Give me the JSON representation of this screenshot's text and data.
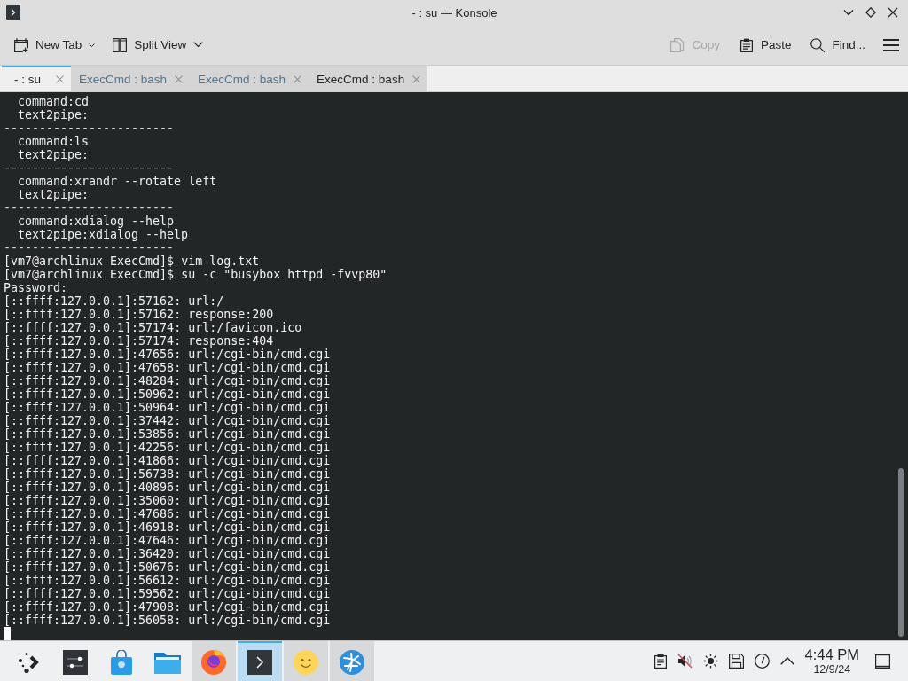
{
  "window": {
    "title": "- : su — Konsole"
  },
  "toolbar": {
    "left": [
      {
        "label": "New Tab",
        "disabled": false
      },
      {
        "label": "Split View",
        "disabled": false
      }
    ],
    "right": [
      {
        "label": "Copy",
        "disabled": true
      },
      {
        "label": "Paste",
        "disabled": false
      },
      {
        "label": "Find...",
        "disabled": false
      }
    ]
  },
  "tabs": [
    {
      "label": "- : su",
      "selected": true,
      "activity": false
    },
    {
      "label": "ExecCmd : bash",
      "selected": false,
      "activity": true
    },
    {
      "label": "ExecCmd : bash",
      "selected": false,
      "activity": true
    },
    {
      "label": "ExecCmd : bash",
      "selected": false,
      "activity": false
    }
  ],
  "terminal": {
    "lines": [
      {
        "kind": "field",
        "text": "command:cd"
      },
      {
        "kind": "field",
        "text": "text2pipe:"
      },
      {
        "kind": "rule",
        "text": "------------------------"
      },
      {
        "kind": "field",
        "text": "command:ls"
      },
      {
        "kind": "field",
        "text": "text2pipe:"
      },
      {
        "kind": "rule",
        "text": "------------------------"
      },
      {
        "kind": "field",
        "text": "command:xrandr --rotate left"
      },
      {
        "kind": "field",
        "text": "text2pipe:"
      },
      {
        "kind": "rule",
        "text": "------------------------"
      },
      {
        "kind": "field",
        "text": "command:xdialog --help"
      },
      {
        "kind": "field",
        "text": "text2pipe:xdialog --help"
      },
      {
        "kind": "rule",
        "text": "------------------------"
      },
      {
        "kind": "line",
        "text": "[vm7@archlinux ExecCmd]$ vim log.txt"
      },
      {
        "kind": "line",
        "text": "[vm7@archlinux ExecCmd]$ su -c \"busybox httpd -fvvp80\""
      },
      {
        "kind": "line",
        "text": "Password:"
      },
      {
        "kind": "line",
        "text": "[::ffff:127.0.0.1]:57162: url:/"
      },
      {
        "kind": "line",
        "text": "[::ffff:127.0.0.1]:57162: response:200"
      },
      {
        "kind": "line",
        "text": "[::ffff:127.0.0.1]:57174: url:/favicon.ico"
      },
      {
        "kind": "line",
        "text": "[::ffff:127.0.0.1]:57174: response:404"
      },
      {
        "kind": "line",
        "text": "[::ffff:127.0.0.1]:47656: url:/cgi-bin/cmd.cgi"
      },
      {
        "kind": "line",
        "text": "[::ffff:127.0.0.1]:47658: url:/cgi-bin/cmd.cgi"
      },
      {
        "kind": "line",
        "text": "[::ffff:127.0.0.1]:48284: url:/cgi-bin/cmd.cgi"
      },
      {
        "kind": "line",
        "text": "[::ffff:127.0.0.1]:50962: url:/cgi-bin/cmd.cgi"
      },
      {
        "kind": "line",
        "text": "[::ffff:127.0.0.1]:50964: url:/cgi-bin/cmd.cgi"
      },
      {
        "kind": "line",
        "text": "[::ffff:127.0.0.1]:37442: url:/cgi-bin/cmd.cgi"
      },
      {
        "kind": "line",
        "text": "[::ffff:127.0.0.1]:53856: url:/cgi-bin/cmd.cgi"
      },
      {
        "kind": "line",
        "text": "[::ffff:127.0.0.1]:42256: url:/cgi-bin/cmd.cgi"
      },
      {
        "kind": "line",
        "text": "[::ffff:127.0.0.1]:41866: url:/cgi-bin/cmd.cgi"
      },
      {
        "kind": "line",
        "text": "[::ffff:127.0.0.1]:56738: url:/cgi-bin/cmd.cgi"
      },
      {
        "kind": "line",
        "text": "[::ffff:127.0.0.1]:40896: url:/cgi-bin/cmd.cgi"
      },
      {
        "kind": "line",
        "text": "[::ffff:127.0.0.1]:35060: url:/cgi-bin/cmd.cgi"
      },
      {
        "kind": "line",
        "text": "[::ffff:127.0.0.1]:47686: url:/cgi-bin/cmd.cgi"
      },
      {
        "kind": "line",
        "text": "[::ffff:127.0.0.1]:46918: url:/cgi-bin/cmd.cgi"
      },
      {
        "kind": "line",
        "text": "[::ffff:127.0.0.1]:47646: url:/cgi-bin/cmd.cgi"
      },
      {
        "kind": "line",
        "text": "[::ffff:127.0.0.1]:36420: url:/cgi-bin/cmd.cgi"
      },
      {
        "kind": "line",
        "text": "[::ffff:127.0.0.1]:50676: url:/cgi-bin/cmd.cgi"
      },
      {
        "kind": "line",
        "text": "[::ffff:127.0.0.1]:56612: url:/cgi-bin/cmd.cgi"
      },
      {
        "kind": "line",
        "text": "[::ffff:127.0.0.1]:59562: url:/cgi-bin/cmd.cgi"
      },
      {
        "kind": "line",
        "text": "[::ffff:127.0.0.1]:47908: url:/cgi-bin/cmd.cgi"
      },
      {
        "kind": "line",
        "text": "[::ffff:127.0.0.1]:56058: url:/cgi-bin/cmd.cgi"
      }
    ]
  },
  "taskbar": {
    "tasks": [
      {
        "kind": "launcher",
        "running": false,
        "selected": false
      },
      {
        "kind": "settings",
        "running": false,
        "selected": false
      },
      {
        "kind": "store",
        "running": false,
        "selected": false
      },
      {
        "kind": "files",
        "running": false,
        "selected": false
      },
      {
        "kind": "browser",
        "running": true,
        "selected": false
      },
      {
        "kind": "terminal",
        "running": true,
        "selected": true
      },
      {
        "kind": "emoji",
        "running": true,
        "selected": false
      },
      {
        "kind": "globe",
        "running": true,
        "selected": false
      }
    ],
    "tray": {
      "volume_muted": true
    },
    "clock": {
      "time": "4:44 PM",
      "date": "12/9/24"
    }
  }
}
